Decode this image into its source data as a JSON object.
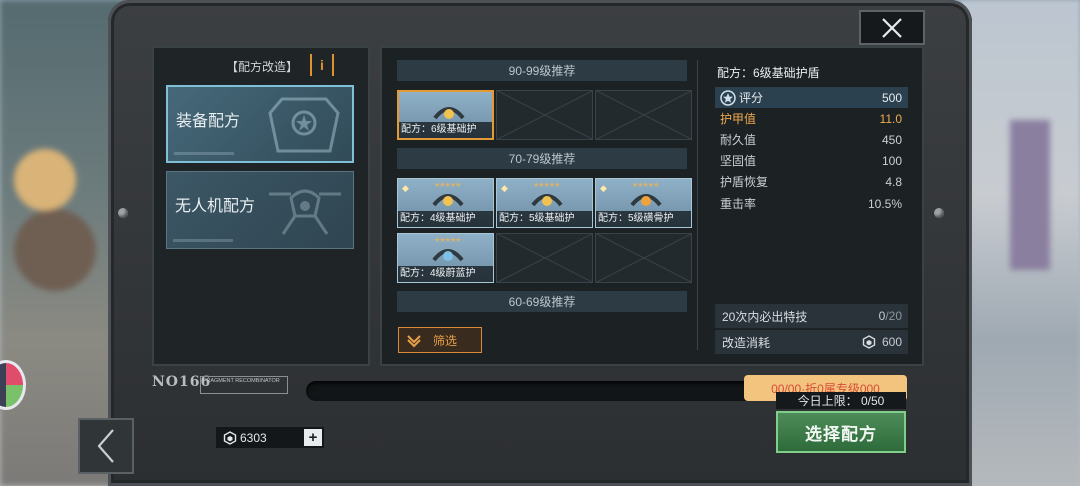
{
  "close_icon": "close-icon",
  "left_panel": {
    "title": "【配方改造】",
    "info_label": "i",
    "categories": [
      {
        "label": "装备配方",
        "icon": "armor-icon",
        "active": true
      },
      {
        "label": "无人机配方",
        "icon": "drone-icon",
        "active": false
      }
    ]
  },
  "groups": [
    {
      "header": "90-99级推荐",
      "items": [
        {
          "caption": "配方：6级基础护",
          "selected": true
        }
      ]
    },
    {
      "header": "70-79级推荐",
      "items": [
        {
          "caption": "配方：4级基础护",
          "selected": false
        },
        {
          "caption": "配方：5级基础护",
          "selected": false
        },
        {
          "caption": "配方：5级磺骨护",
          "selected": false
        },
        {
          "caption": "配方：4级蔚蓝护",
          "selected": false
        }
      ]
    },
    {
      "header": "60-69级推荐",
      "items": []
    }
  ],
  "filter_label": "筛选",
  "detail": {
    "title": "配方：6级基础护盾",
    "stats": [
      {
        "name": "评分",
        "value": "500"
      },
      {
        "name": "护甲值",
        "value": "11.0"
      },
      {
        "name": "耐久值",
        "value": "450"
      },
      {
        "name": "坚固值",
        "value": "100"
      },
      {
        "name": "护盾恢复",
        "value": "4.8"
      },
      {
        "name": "重击率",
        "value": "10.5%"
      }
    ],
    "guarantee": {
      "label": "20次内必出特技",
      "current": "0",
      "total": "/20"
    },
    "cost": {
      "label": "改造消耗",
      "value": "600"
    }
  },
  "nameplate": {
    "model": "NO166",
    "sub": "FRAGMENT RECOMBINATOR"
  },
  "currency": {
    "amount": "6303",
    "plus": "+"
  },
  "promo_text": "00/00·折0属专级000",
  "daily_limit": "今日上限： 0/50",
  "select_button": "选择配方",
  "colors": {
    "accent_orange": "#e49a35",
    "select_green": "#2e6b3b",
    "highlight_stat": "#efab4f"
  }
}
